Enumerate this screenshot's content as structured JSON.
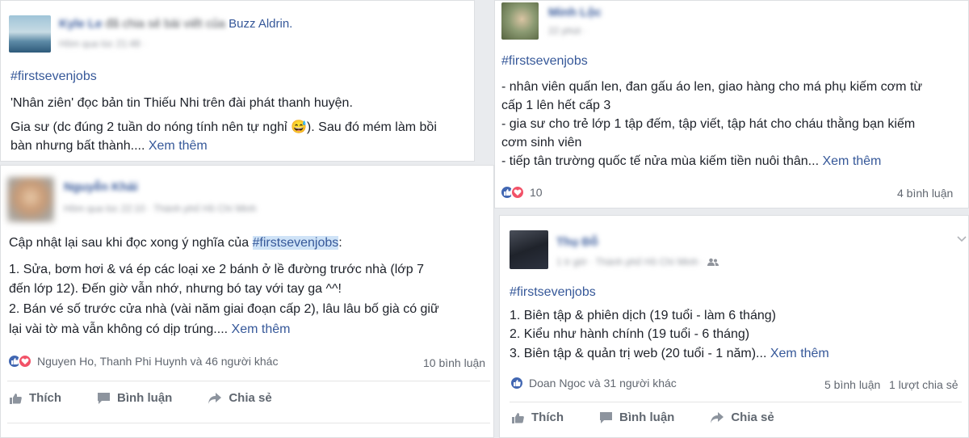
{
  "post1": {
    "author": "Kyle Le",
    "share_text": "đã chia sẻ bài viết của",
    "shared_from": "Buzz Aldrin.",
    "time": "Hôm qua lúc 21:48 · ",
    "hashtag": "#firstsevenjobs",
    "line1": "'Nhân ziên' đọc bản tin Thiếu Nhi trên đài phát thanh huyện.",
    "line2a": "Gia sư (dc đúng 2 tuần do nóng tính nên tự nghỉ ",
    "line2b": "). Sau đó mém làm bồi",
    "line3": "bàn nhưng bất thành.... ",
    "see_more": "Xem thêm",
    "emoji": "😅"
  },
  "post2": {
    "author": "Nguyễn Khải",
    "time": "Hôm qua lúc 22:10 · Thành phố Hồ Chí Minh",
    "intro": "Cập nhật lại sau khi đọc xong ý nghĩa của ",
    "hashtag": "#firstsevenjobs",
    "intro_end": ":",
    "line1": "1. Sửa, bơm hơi & vá ép các loại xe 2 bánh ở lề đường trước nhà (lớp 7",
    "line2": "đến lớp 12). Đến giờ vẫn nhớ, nhưng bó tay với tay ga ^^!",
    "line3": "2. Bán vé số trước cửa nhà (vài năm giai đoạn cấp 2), lâu lâu bố già có giữ",
    "line4": "lại vài tờ mà vẫn không có dịp trúng.... ",
    "see_more": "Xem thêm",
    "reactions": "Nguyen Ho, Thanh Phi Huynh và 46 người khác",
    "comments": "10 bình luận",
    "actions": {
      "like": "Thích",
      "comment": "Bình luận",
      "share": "Chia sẻ"
    }
  },
  "post3": {
    "author": "Minh Lộc",
    "time": "22 phút · ",
    "hashtag": "#firstsevenjobs",
    "line1": "- nhân viên quấn len, đan gấu áo len, giao hàng cho má phụ kiếm cơm từ",
    "line2": "cấp 1 lên hết cấp 3",
    "line3": "- gia sư cho trẻ lớp 1 tập đếm, tập viết, tập hát cho cháu thằng bạn kiếm",
    "line4": "cơm sinh viên",
    "line5": "- tiếp tân trường quốc tế nửa mùa kiếm tiền nuôi thân... ",
    "see_more": "Xem thêm",
    "reaction_count": "10",
    "comments": "4 bình luận"
  },
  "post4": {
    "author": "Thụ Đỗ",
    "time": "1 tr giờ · Thành phố Hồ Chí Minh · ",
    "hashtag": "#firstsevenjobs",
    "line1": "1. Biên tập & phiên dịch (19 tuổi - làm 6 tháng)",
    "line2": "2. Kiểu như hành chính (19 tuổi - 6 tháng)",
    "line3": "3. Biên tập & quản trị web (20 tuổi - 1 năm)... ",
    "see_more": "Xem thêm",
    "reactions": "Doan Ngoc và 31 người khác",
    "comments": "5 bình luận",
    "shares": "1 lượt chia sẻ",
    "actions": {
      "like": "Thích",
      "comment": "Bình luận",
      "share": "Chia sẻ"
    }
  },
  "colors": {
    "link": "#365899",
    "like": "#4267b2",
    "love": "#f25268"
  }
}
